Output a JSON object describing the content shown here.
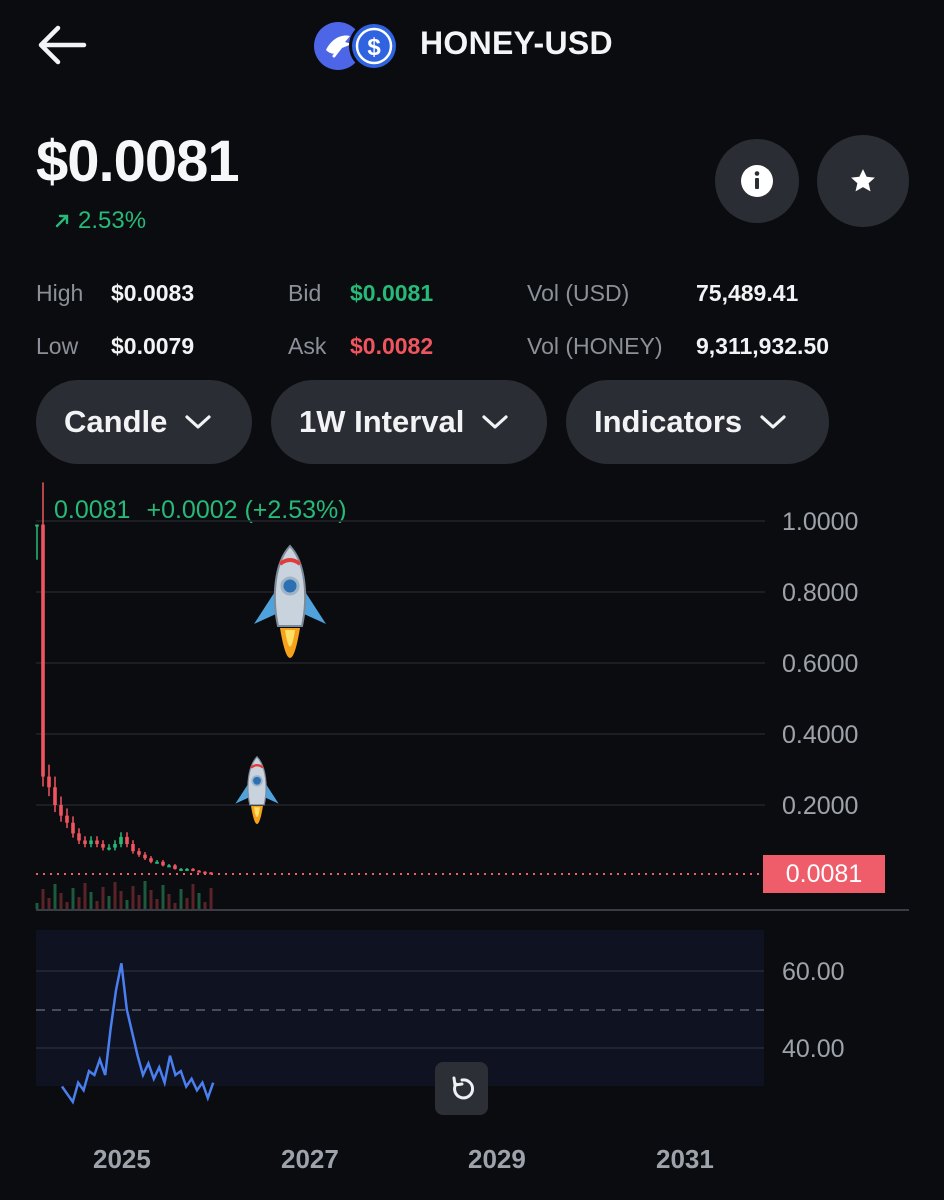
{
  "header": {
    "title": "HONEY-USD",
    "base_icon": "honey-token-icon",
    "quote_icon": "usd-dollar-icon"
  },
  "price": {
    "current": "$0.0081",
    "change_percent": "2.53%",
    "change_direction": "up"
  },
  "stats": {
    "high_label": "High",
    "high_value": "$0.0083",
    "low_label": "Low",
    "low_value": "$0.0079",
    "bid_label": "Bid",
    "bid_value": "$0.0081",
    "ask_label": "Ask",
    "ask_value": "$0.0082",
    "vol_usd_label": "Vol (USD)",
    "vol_usd_value": "75,489.41",
    "vol_base_label": "Vol (HONEY)",
    "vol_base_value": "9,311,932.50"
  },
  "controls": {
    "chart_type": "Candle",
    "interval": "1W Interval",
    "indicators": "Indicators"
  },
  "chart": {
    "legend_price": "0.0081",
    "legend_change": "+0.0002 (+2.53%)",
    "y_labels": [
      "1.0000",
      "0.8000",
      "0.6000",
      "0.4000",
      "0.2000"
    ],
    "current_price_tag": "0.0081",
    "rsi_labels": [
      "60.00",
      "40.00"
    ],
    "x_labels": [
      "2025",
      "2027",
      "2029",
      "2031"
    ],
    "colors": {
      "up": "#27b978",
      "down": "#f0555f",
      "rsi_line": "#4a7ff0"
    }
  },
  "chart_data": {
    "type": "candlestick",
    "price_axis": {
      "ylim": [
        0,
        1.0
      ],
      "ticks": [
        1.0,
        0.8,
        0.6,
        0.4,
        0.2
      ]
    },
    "price_series_approx": [
      0.99,
      0.28,
      0.25,
      0.2,
      0.17,
      0.15,
      0.12,
      0.1,
      0.09,
      0.1,
      0.09,
      0.08,
      0.08,
      0.09,
      0.11,
      0.09,
      0.07,
      0.06,
      0.05,
      0.04,
      0.04,
      0.03,
      0.03,
      0.02,
      0.02,
      0.02,
      0.015,
      0.012,
      0.01,
      0.0081
    ],
    "rsi_axis": {
      "ticks": [
        60,
        40
      ]
    },
    "rsi_series_approx": [
      30,
      28,
      26,
      31,
      29,
      34,
      33,
      37,
      33,
      45,
      55,
      62,
      50,
      44,
      38,
      33,
      36,
      32,
      35,
      31,
      38,
      33,
      34,
      30,
      32,
      29,
      31,
      27,
      31
    ],
    "x_ticks": [
      "2025",
      "2027",
      "2029",
      "2031"
    ]
  }
}
